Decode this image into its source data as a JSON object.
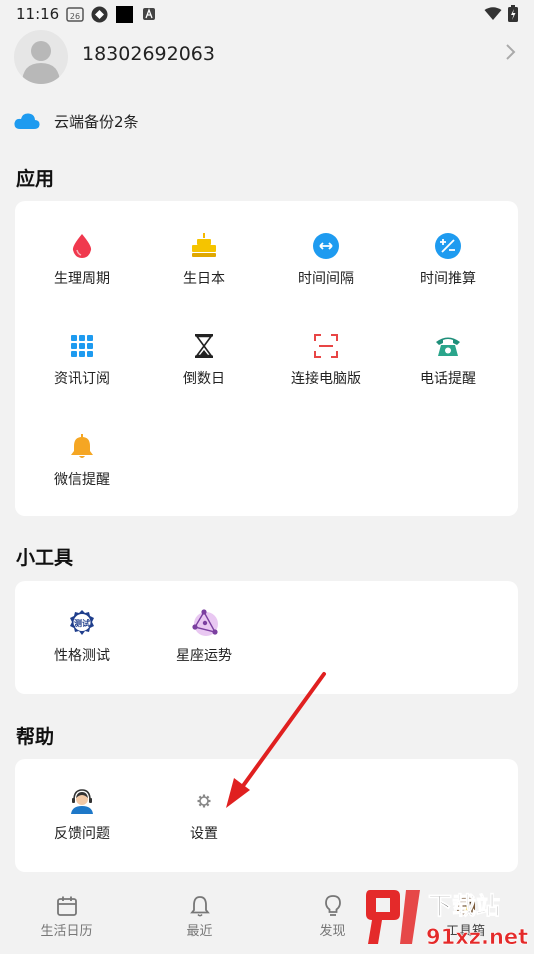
{
  "status_bar": {
    "time": "11:16",
    "calendar_badge": "26"
  },
  "profile": {
    "phone": "18302692063"
  },
  "backup": {
    "label": "云端备份2条"
  },
  "sections": {
    "apps": {
      "title": "应用",
      "items": [
        {
          "label": "生理周期",
          "icon": "blood-drop-icon"
        },
        {
          "label": "生日本",
          "icon": "birthday-cake-icon"
        },
        {
          "label": "时间间隔",
          "icon": "interval-arrows-icon"
        },
        {
          "label": "时间推算",
          "icon": "plus-minus-icon"
        },
        {
          "label": "资讯订阅",
          "icon": "grid-dots-icon"
        },
        {
          "label": "倒数日",
          "icon": "hourglass-icon"
        },
        {
          "label": "连接电脑版",
          "icon": "scan-frame-icon"
        },
        {
          "label": "电话提醒",
          "icon": "telephone-icon"
        },
        {
          "label": "微信提醒",
          "icon": "bell-icon"
        }
      ]
    },
    "tools": {
      "title": "小工具",
      "items": [
        {
          "label": "性格测试",
          "icon": "test-stamp-icon",
          "badge": "测试"
        },
        {
          "label": "星座运势",
          "icon": "constellation-icon"
        }
      ]
    },
    "help": {
      "title": "帮助",
      "items": [
        {
          "label": "反馈问题",
          "icon": "customer-service-icon"
        },
        {
          "label": "设置",
          "icon": "gear-icon"
        }
      ]
    }
  },
  "tabbar": {
    "tabs": [
      {
        "label": "生活日历",
        "icon": "calendar-icon"
      },
      {
        "label": "最近",
        "icon": "bell-outline-icon"
      },
      {
        "label": "发现",
        "icon": "lightbulb-icon"
      },
      {
        "label": "工具箱",
        "icon": "toolbox-icon"
      }
    ]
  },
  "watermark": {
    "text1": "下载站",
    "text2": "91xz.net"
  },
  "colors": {
    "accent": "#1e9bf0",
    "arrow": "#e02020",
    "background": "#f2f2f2"
  }
}
